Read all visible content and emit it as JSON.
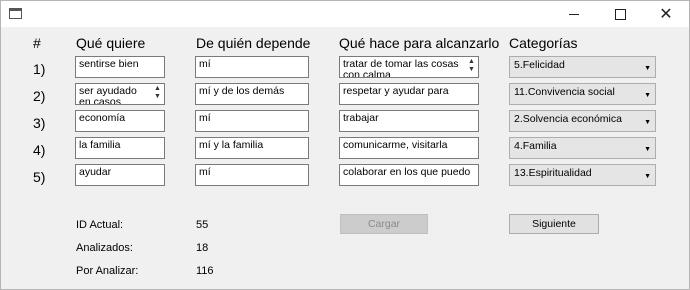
{
  "window": {
    "title": ""
  },
  "headers": {
    "num": "#",
    "que_quiere": "Qué quiere",
    "de_quien": "De quién depende",
    "que_hace": "Qué hace para alcanzarlo",
    "categorias": "Categorías"
  },
  "rows": [
    {
      "num": "1)",
      "quiere": "sentirse bien",
      "depende": "mí",
      "hace": "tratar de tomar las cosas con calma",
      "categoria": "5.Felicidad"
    },
    {
      "num": "2)",
      "quiere": "ser ayudado en casos necesarios",
      "depende": "mí y de los demás",
      "hace": "respetar y ayudar para",
      "categoria": "11.Convivencia social"
    },
    {
      "num": "3)",
      "quiere": "economía",
      "depende": "mí",
      "hace": "trabajar",
      "categoria": "2.Solvencia económica"
    },
    {
      "num": "4)",
      "quiere": "la familia",
      "depende": "mí y la familia",
      "hace": "comunicarme, visitarla",
      "categoria": "4.Familia"
    },
    {
      "num": "5)",
      "quiere": "ayudar",
      "depende": "mí",
      "hace": "colaborar en los que puedo",
      "categoria": "13.Espiritualidad"
    }
  ],
  "stats": {
    "id_label": "ID Actual:",
    "id_value": "55",
    "analizados_label": "Analizados:",
    "analizados_value": "18",
    "por_analizar_label": "Por Analizar:",
    "por_analizar_value": "116"
  },
  "buttons": {
    "cargar": "Cargar",
    "siguiente": "Siguiente"
  },
  "icons": {
    "spin_up": "▲",
    "spin_down": "▼",
    "combo_arrow": "▼",
    "close": "✕"
  }
}
